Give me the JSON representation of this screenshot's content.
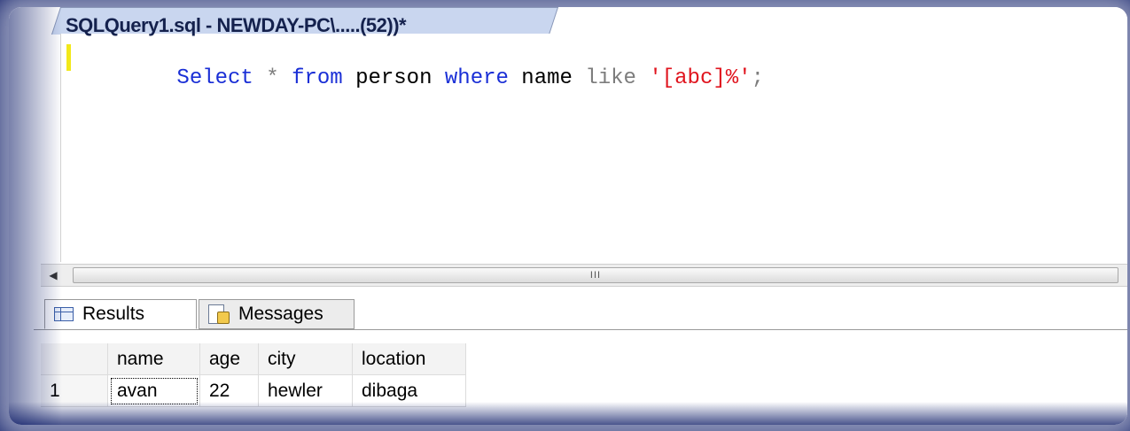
{
  "document_tab": {
    "title": "SQLQuery1.sql - NEWDAY-PC\\.....(52))*"
  },
  "editor": {
    "tokens": [
      {
        "text": "Select",
        "kind": "kw"
      },
      {
        "text": " ",
        "kind": "sp"
      },
      {
        "text": "*",
        "kind": "op"
      },
      {
        "text": " ",
        "kind": "sp"
      },
      {
        "text": "from",
        "kind": "kw"
      },
      {
        "text": " person ",
        "kind": "plain"
      },
      {
        "text": "where",
        "kind": "kw"
      },
      {
        "text": " name ",
        "kind": "plain"
      },
      {
        "text": "like",
        "kind": "op"
      },
      {
        "text": " ",
        "kind": "sp"
      },
      {
        "text": "'[abc]%'",
        "kind": "str"
      },
      {
        "text": ";",
        "kind": "op"
      }
    ]
  },
  "scrollbar": {
    "left_arrow": "◀",
    "grip": "III"
  },
  "results_tabs": {
    "results_label": "Results",
    "messages_label": "Messages"
  },
  "results_grid": {
    "columns": [
      "",
      "name",
      "age",
      "city",
      "location"
    ],
    "rows": [
      [
        "1",
        "avan",
        "22",
        "hewler",
        "dibaga"
      ]
    ]
  },
  "colors": {
    "keyword": "#1a2fd6",
    "string": "#e0141e",
    "operator": "#7d7d7d",
    "frame": "#0b1a66"
  }
}
